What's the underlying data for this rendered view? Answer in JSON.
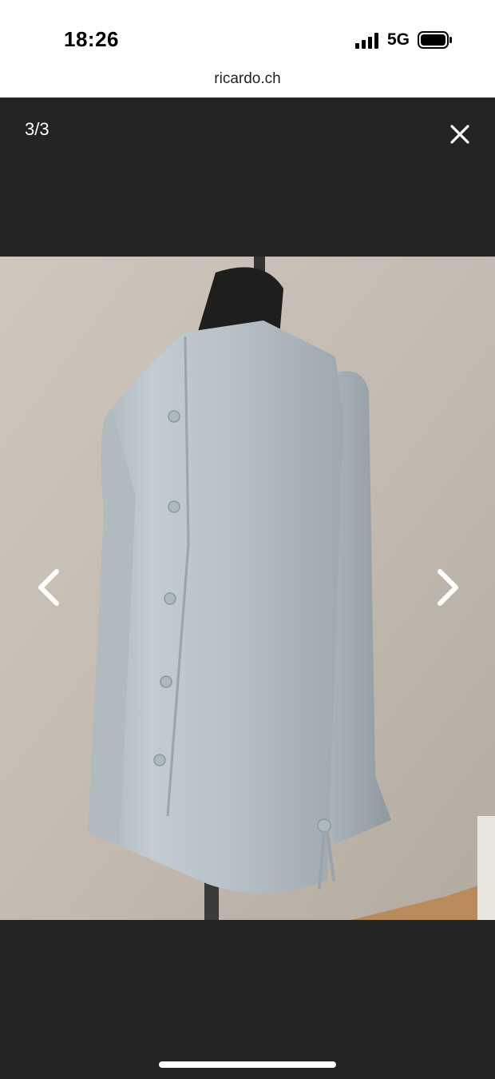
{
  "status": {
    "time": "18:26",
    "network": "5G",
    "icons": [
      "signal-icon",
      "battery-icon"
    ]
  },
  "browser": {
    "url": "ricardo.ch"
  },
  "viewer": {
    "counter": "3/3",
    "icons": [
      "close-icon",
      "chevron-left-icon",
      "chevron-right-icon"
    ],
    "image_subject": "light blue blouse on mannequin, back view"
  },
  "colors": {
    "background": "#242424",
    "statusbar": "#ffffff",
    "icon": "#ffffff"
  }
}
